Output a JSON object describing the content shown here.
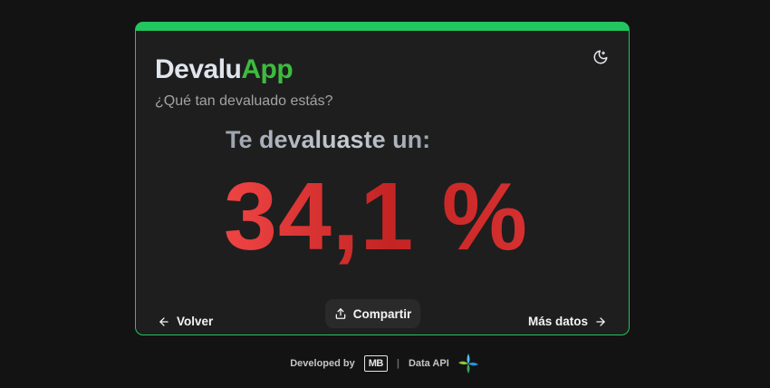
{
  "app": {
    "title_part1": "Devalu",
    "title_part2": "App",
    "subtitle": "¿Qué tan devaluado estás?"
  },
  "result": {
    "label": "Te devaluaste un:",
    "value": "34,1 %"
  },
  "actions": {
    "back_label": "Volver",
    "share_label": "Compartir",
    "more_label": "Más datos"
  },
  "footer": {
    "developed_by": "Developed by",
    "developer_logo": "MB",
    "separator": "|",
    "data_api": "Data API"
  },
  "icons": {
    "theme_toggle": "moon-icon",
    "back": "arrow-left-icon",
    "share": "upload-icon",
    "more": "arrow-right-icon",
    "data_api_logo": "data-api-logo-icon"
  },
  "colors": {
    "background": "#131313",
    "card": "#1e1e1e",
    "accent_green": "#22c55e",
    "logo_green": "#3dbb3f",
    "value_red": "#ef4444"
  }
}
